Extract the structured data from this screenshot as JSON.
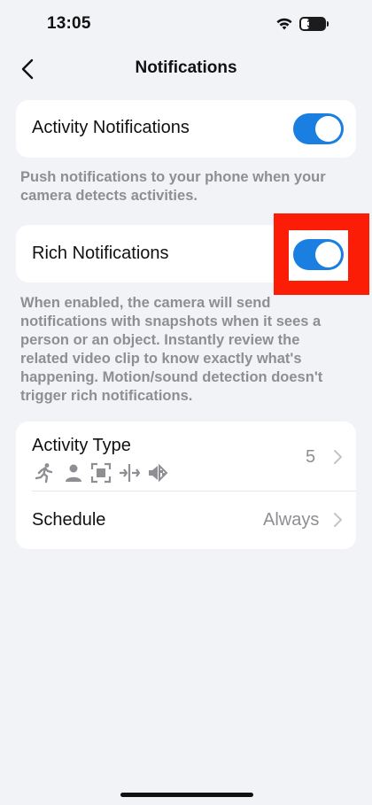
{
  "status_bar": {
    "time": "13:05",
    "battery": "33",
    "battery_level": 0.33
  },
  "nav": {
    "title": "Notifications",
    "back_icon": "chevron-left-icon"
  },
  "activity_notifications": {
    "label": "Activity Notifications",
    "enabled": true,
    "description": "Push notifications to your phone when your camera detects activities."
  },
  "rich_notifications": {
    "label": "Rich Notifications",
    "enabled": true,
    "description": "When enabled, the camera will send notifications with snapshots when it sees a person or an object. Instantly review the related video clip to know exactly what's happening. Motion/sound detection doesn't trigger rich notifications."
  },
  "activity_type": {
    "label": "Activity Type",
    "value": "5",
    "icons": [
      "running-person-icon",
      "person-icon",
      "object-frame-icon",
      "crossing-line-icon",
      "sound-icon"
    ]
  },
  "schedule": {
    "label": "Schedule",
    "value": "Always"
  },
  "colors": {
    "accent": "#1a7fe1",
    "highlight": "#fb1d06",
    "background": "#f2f3f7",
    "secondary_text": "#8e8e93"
  }
}
